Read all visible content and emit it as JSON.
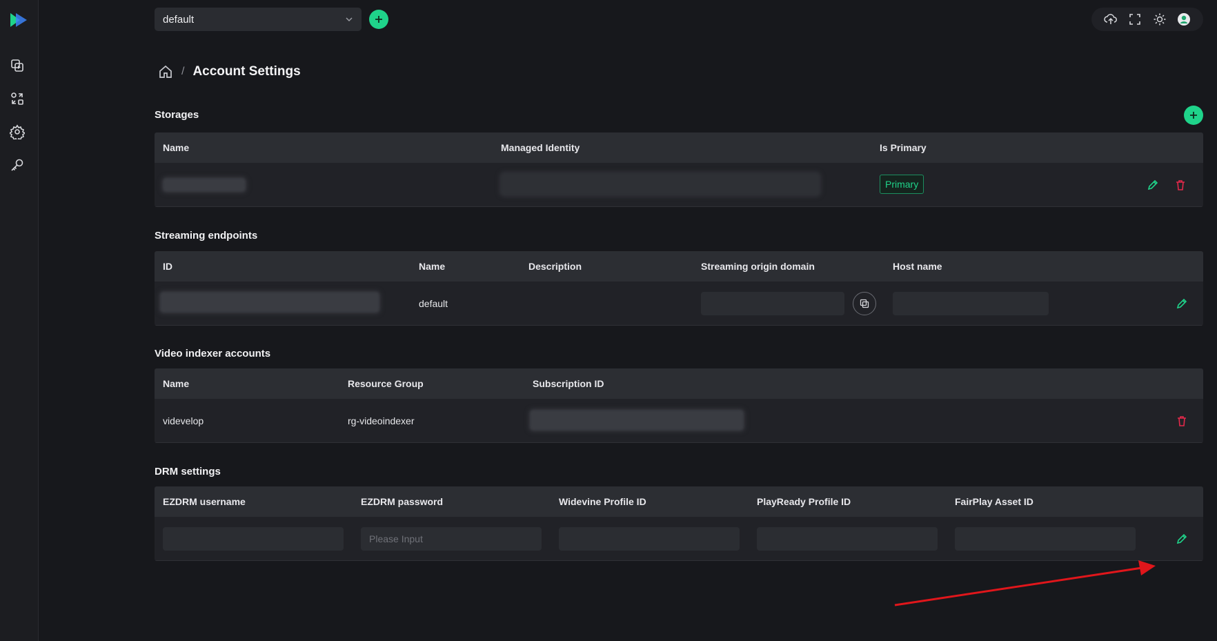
{
  "topbar": {
    "account_select": "default"
  },
  "breadcrumb": {
    "separator": "/",
    "title": "Account Settings"
  },
  "storages": {
    "title": "Storages",
    "columns": [
      "Name",
      "Managed Identity",
      "Is Primary"
    ],
    "rows": [
      {
        "is_primary": "Primary"
      }
    ]
  },
  "streaming": {
    "title": "Streaming endpoints",
    "columns": [
      "ID",
      "Name",
      "Description",
      "Streaming origin domain",
      "Host name"
    ],
    "rows": [
      {
        "name": "default"
      }
    ]
  },
  "indexer": {
    "title": "Video indexer accounts",
    "columns": [
      "Name",
      "Resource Group",
      "Subscription ID"
    ],
    "rows": [
      {
        "name": "videvelop",
        "resource_group": "rg-videoindexer"
      }
    ]
  },
  "drm": {
    "title": "DRM settings",
    "columns": [
      "EZDRM username",
      "EZDRM password",
      "Widevine Profile ID",
      "PlayReady Profile ID",
      "FairPlay Asset ID"
    ],
    "password_placeholder": "Please Input"
  },
  "colors": {
    "accent": "#1fd38a",
    "danger": "#e5294b",
    "annotation_arrow": "#e0161b"
  }
}
